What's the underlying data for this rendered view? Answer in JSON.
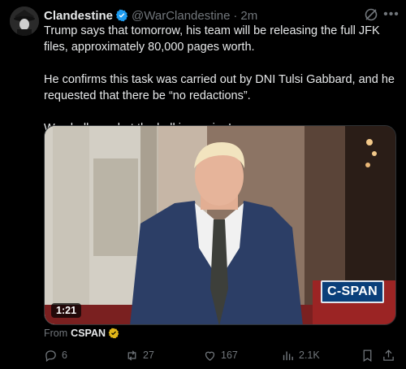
{
  "tweet": {
    "author_name": "Clandestine",
    "handle": "@WarClandestine",
    "separator": "·",
    "time": "2m",
    "paragraphs": [
      "Trump says that tomorrow, his team will be releasing the full JFK files, approximately 80,000 pages worth.",
      "He confirms this task was carried out by DNI Tulsi Gabbard, and he requested that there be “no redactions”.",
      "We shall see, but the ball is moving!"
    ]
  },
  "media": {
    "duration": "1:21",
    "watermark": "C-SPAN"
  },
  "source": {
    "from_label": "From",
    "name": "CSPAN"
  },
  "actions": {
    "replies": "6",
    "reposts": "27",
    "likes": "167",
    "views": "2.1K"
  },
  "colors": {
    "background": "#000000",
    "text": "#e7e9ea",
    "muted": "#71767b",
    "verified_blue": "#1d9bf0",
    "verified_gold": "#e2b719"
  },
  "icons": [
    "avatar",
    "verified-badge-icon",
    "grok-icon",
    "more-icon",
    "gold-badge-icon",
    "reply-icon",
    "repost-icon",
    "like-icon",
    "views-icon",
    "bookmark-icon",
    "share-icon"
  ]
}
